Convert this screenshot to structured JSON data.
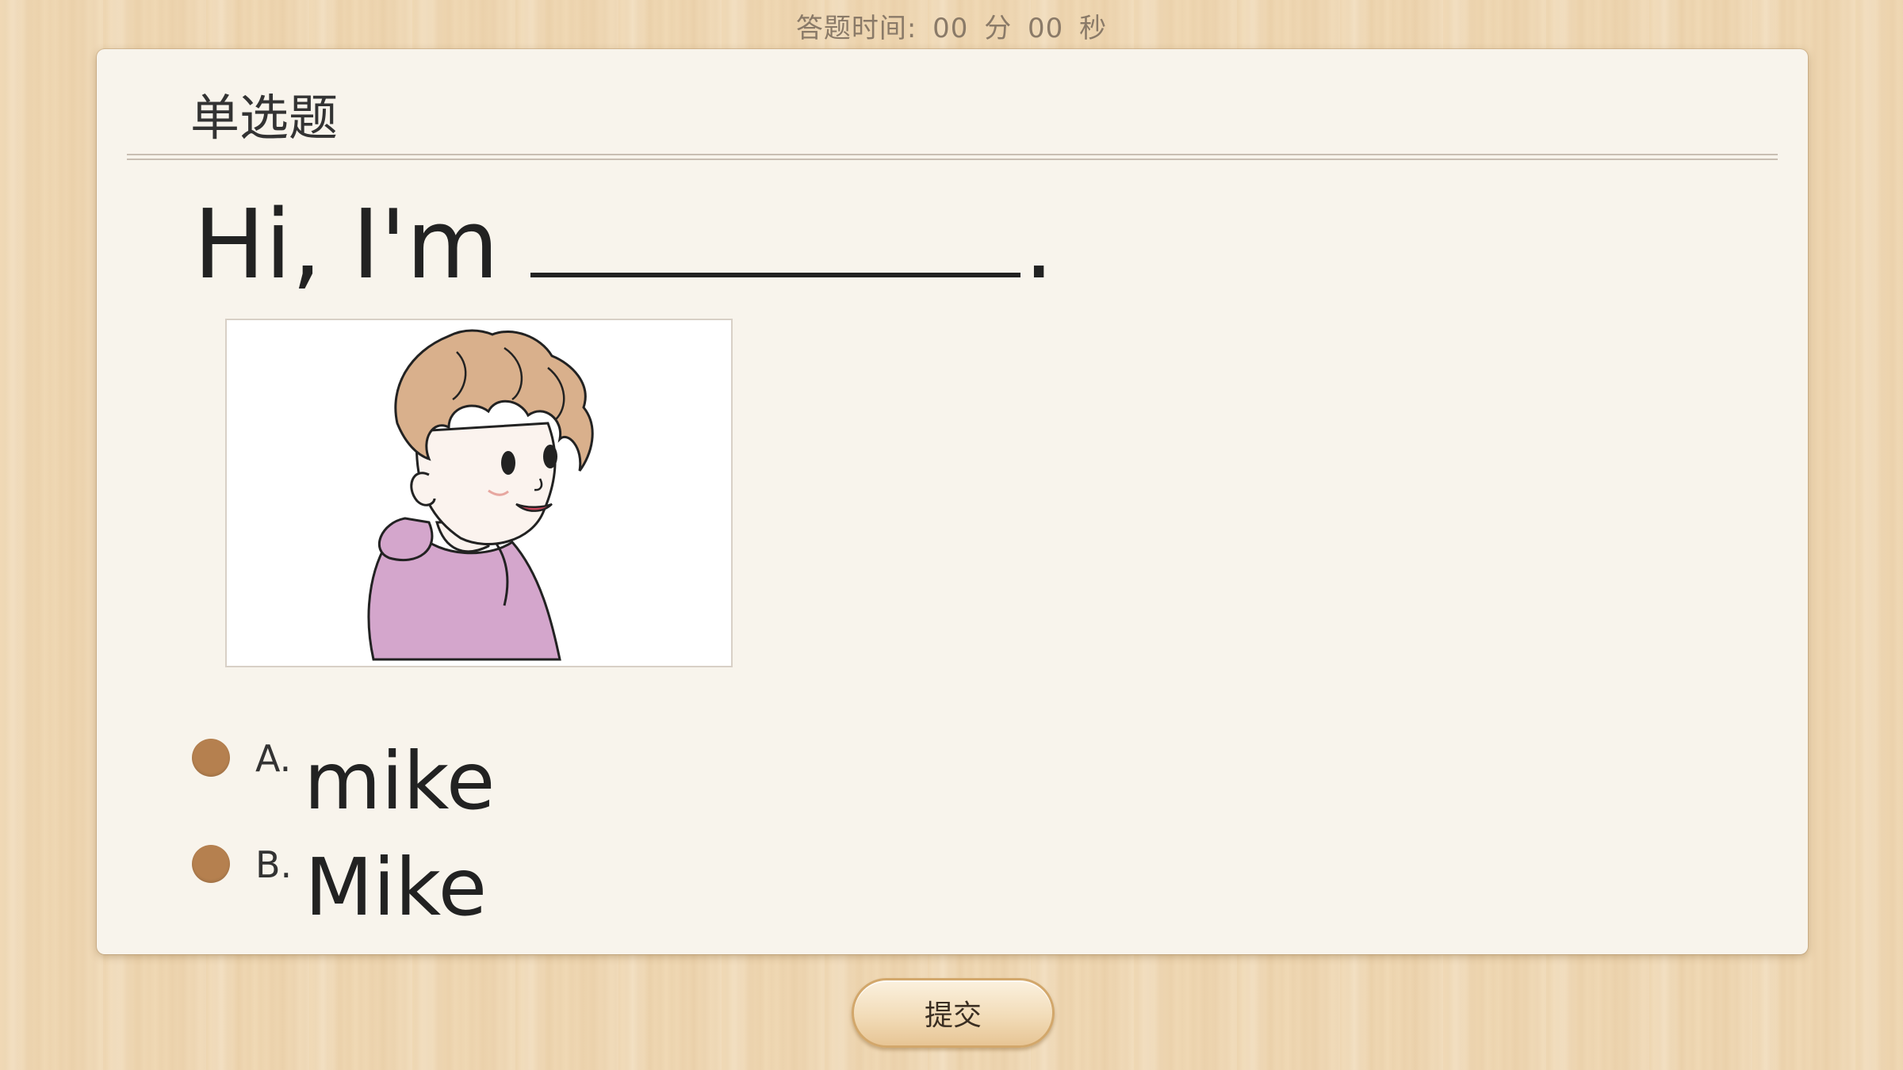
{
  "timer": {
    "label": "答题时间:",
    "minutes": "00",
    "minutes_unit": "分",
    "seconds": "00",
    "seconds_unit": "秒"
  },
  "card": {
    "question_type": "单选题",
    "question_text": "Hi, I'm",
    "question_end": ".",
    "options": [
      {
        "letter": "A.",
        "text": "mike"
      },
      {
        "letter": "B.",
        "text": "Mike"
      }
    ]
  },
  "submit_label": "提交",
  "colors": {
    "radio": "#b5804f",
    "card_bg": "#f8f4ec",
    "wood_bg": "#f0d9b5",
    "hoodie": "#d4a6cc",
    "hair": "#d9b08c"
  },
  "icons": {
    "radio_a": "radio-unselected-icon",
    "radio_b": "radio-unselected-icon"
  }
}
